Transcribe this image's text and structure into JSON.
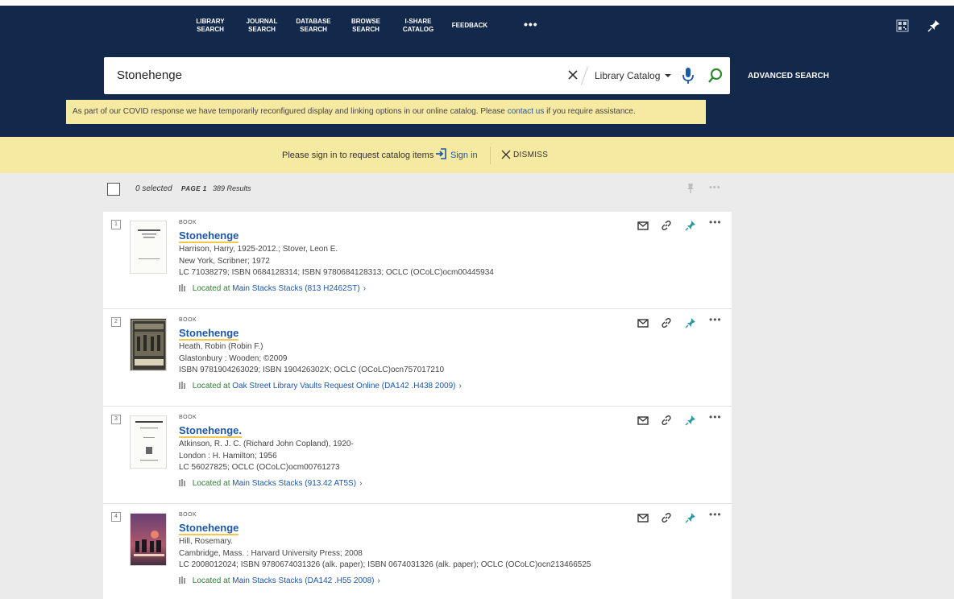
{
  "nav": {
    "items": [
      {
        "line1": "LIBRARY",
        "line2": "SEARCH"
      },
      {
        "line1": "JOURNAL",
        "line2": "SEARCH"
      },
      {
        "line1": "DATABASE",
        "line2": "SEARCH"
      },
      {
        "line1": "BROWSE",
        "line2": "SEARCH"
      },
      {
        "line1": "I-SHARE",
        "line2": "CATALOG"
      },
      {
        "line1": "FEEDBACK",
        "line2": ""
      }
    ],
    "more": "•••"
  },
  "search": {
    "query": "Stonehenge",
    "scope": "Library Catalog",
    "advanced": "ADVANCED SEARCH"
  },
  "covid": {
    "before": "As part of our COVID response we have temporarily reconfigured display and linking options in our online catalog. Please ",
    "link": "contact us",
    "after": " if you require assistance."
  },
  "signbar": {
    "message": "Please sign in to request catalog items",
    "signin": "Sign in",
    "dismiss": "DISMISS"
  },
  "results_header": {
    "selected": "0 selected",
    "page": "PAGE 1",
    "count": "389 Results",
    "more": "•••"
  },
  "results": [
    {
      "num": "1",
      "type": "BOOK",
      "title": "Stonehenge",
      "author": "Harrison, Harry, 1925-2012.; Stover, Leon E.",
      "pub": "New York, Scribner; 1972",
      "ids": "LC 71038279; ISBN 0684128314; ISBN 9780684128313; OCLC (OCoLC)ocm00445934",
      "loc_label": "Located at",
      "loc_link": "Main Stacks  Stacks (813 H2462ST)"
    },
    {
      "num": "2",
      "type": "BOOK",
      "title": "Stonehenge",
      "author": "Heath, Robin (Robin F.)",
      "pub": "Glastonbury : Wooden; ©2009",
      "ids": "ISBN 9781904263029; ISBN 190426302X; OCLC (OCoLC)ocn757017210",
      "loc_label": "Located at",
      "loc_link": "Oak Street Library  Vaults Request Online (DA142 .H438 2009)"
    },
    {
      "num": "3",
      "type": "BOOK",
      "title": "Stonehenge.",
      "author": "Atkinson, R. J. C. (Richard John Copland), 1920-",
      "pub": "London : H. Hamilton; 1956",
      "ids": "LC 56027825; OCLC (OCoLC)ocm00761273",
      "loc_label": "Located at",
      "loc_link": "Main Stacks  Stacks (913.42 AT5S)"
    },
    {
      "num": "4",
      "type": "BOOK",
      "title": "Stonehenge",
      "author": "Hill, Rosemary.",
      "pub": "Cambridge, Mass. : Harvard University Press; 2008",
      "ids": "LC 2008012024; ISBN 9780674031326 (alk. paper); ISBN 0674031326 (alk. paper); OCLC (OCoLC)ocn213466525",
      "loc_label": "Located at",
      "loc_link": "Main Stacks  Stacks (DA142 .H55 2008)"
    }
  ],
  "colors": {
    "navy": "#13294b",
    "banner": "#f6e9a2",
    "link": "#1d58a7",
    "available": "#2e7d32",
    "pin": "#2b9aa5"
  }
}
